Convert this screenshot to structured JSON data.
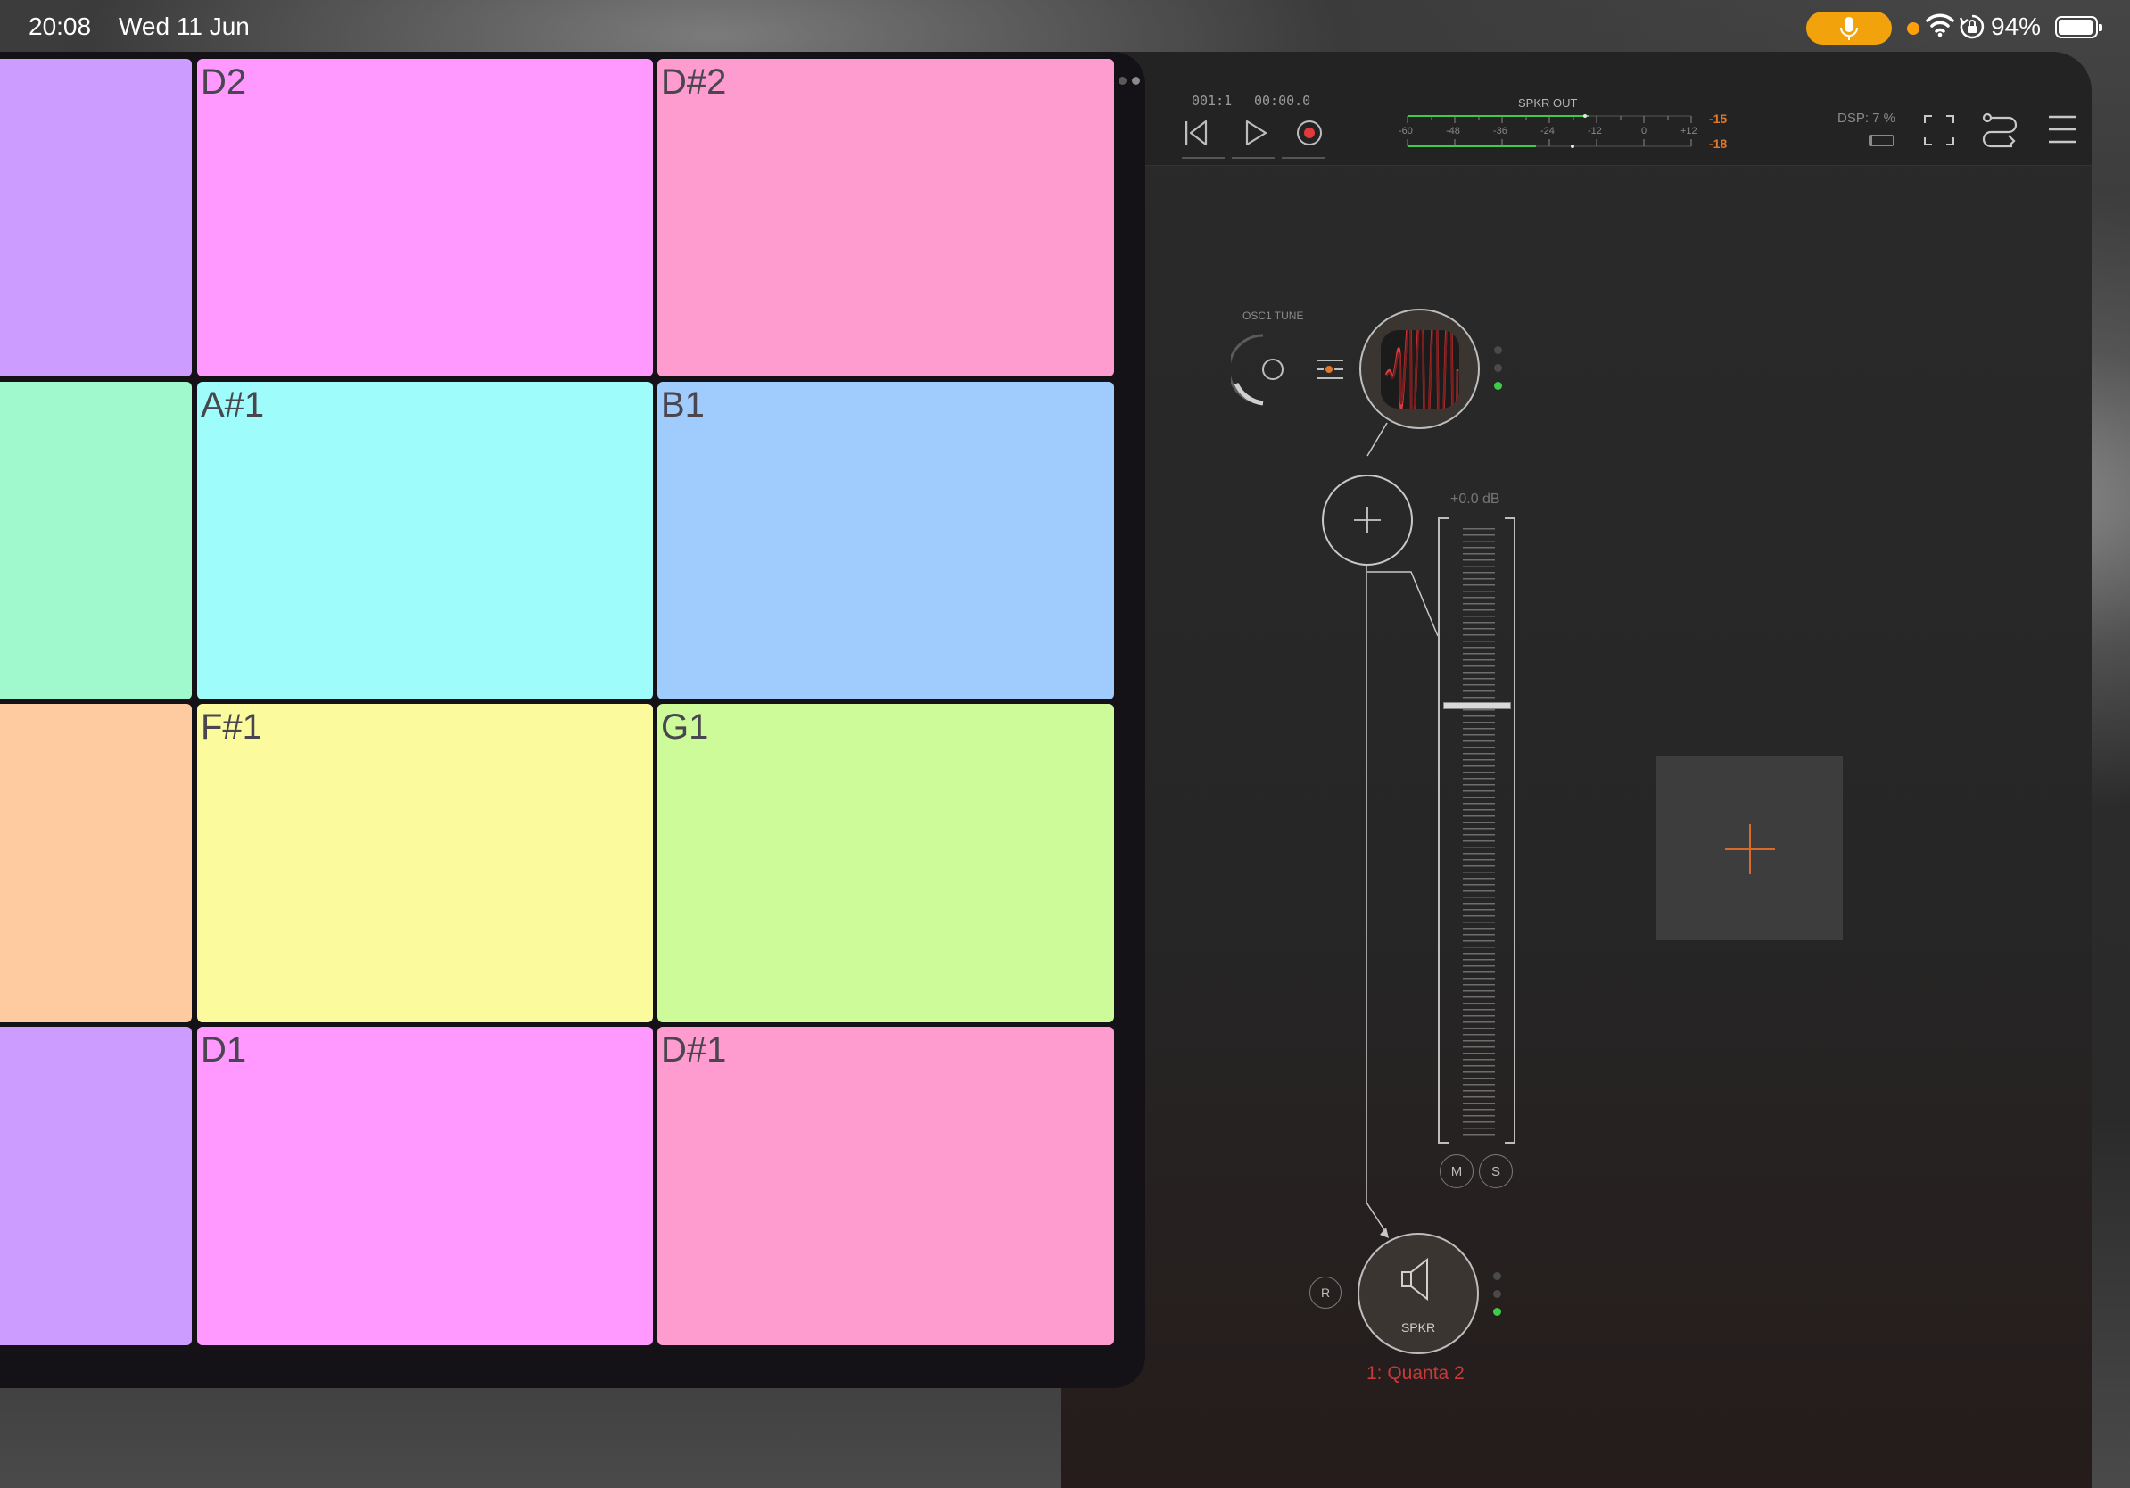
{
  "status_bar": {
    "time": "20:08",
    "date": "Wed 11 Jun",
    "battery_percent": "94%",
    "battery_level": 0.94,
    "mic_indicator_color": "#f2a20b",
    "icons": [
      "mic-icon",
      "wifi-icon",
      "orientation-lock-icon",
      "battery-icon"
    ]
  },
  "host": {
    "position": "001:1",
    "time": "00:00.0",
    "meter": {
      "label": "SPKR OUT",
      "ticks": [
        "-60",
        "-48",
        "-36",
        "-24",
        "-12",
        "0",
        "+12"
      ],
      "peak_top": "-15",
      "peak_bottom": "-18",
      "peak_color": "#e0782b"
    },
    "dsp_label": "DSP:  7 %",
    "dsp_level": 0.07,
    "icons": [
      "rewind-icon",
      "play-icon",
      "record-icon",
      "fullscreen-icon",
      "routing-icon",
      "menu-icon"
    ]
  },
  "pads": {
    "rows": [
      [
        {
          "label": "",
          "color": "#cc9dff"
        },
        {
          "label": "D2",
          "color": "#ff98ff"
        },
        {
          "label": "D#2",
          "color": "#ff9ccf"
        }
      ],
      [
        {
          "label": "",
          "color": "#9ff9cd"
        },
        {
          "label": "A#1",
          "color": "#9efcfb"
        },
        {
          "label": "B1",
          "color": "#9fcbfd"
        }
      ],
      [
        {
          "label": "",
          "color": "#fdcb9f"
        },
        {
          "label": "F#1",
          "color": "#fbfa9c"
        },
        {
          "label": "G1",
          "color": "#cdfb9a"
        }
      ],
      [
        {
          "label": "",
          "color": "#cc9dff"
        },
        {
          "label": "D1",
          "color": "#ff98ff"
        },
        {
          "label": "D#1",
          "color": "#ff9ccf"
        }
      ]
    ]
  },
  "strip": {
    "knob_label": "OSC1 TUNE",
    "gain_label": "+0.0 dB",
    "fader_level_db": 0.0,
    "mute_label": "M",
    "solo_label": "S",
    "record_label": "R",
    "output_label": "SPKR",
    "channel_name": "1: Quanta 2",
    "channel_color": "#c83a3a",
    "add_color": "#d96a2b",
    "active_led_color": "#3ecb4a"
  }
}
